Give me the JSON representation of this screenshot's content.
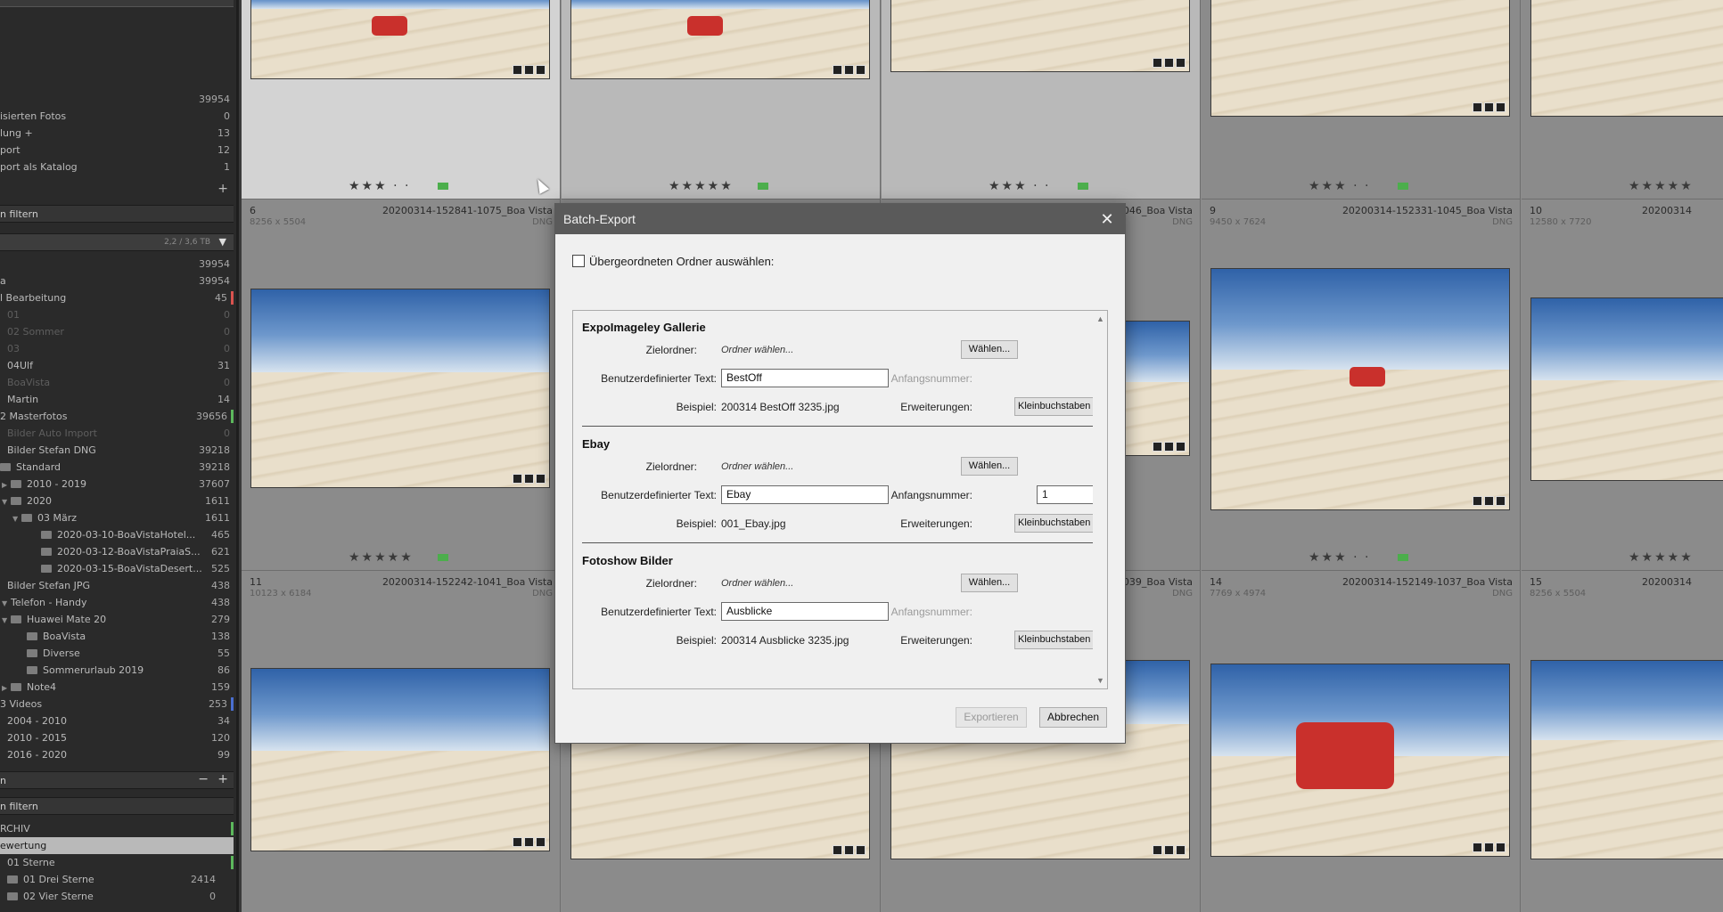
{
  "left_panel": {
    "total_count": "39954",
    "top_items": [
      {
        "label": "isierten Fotos",
        "count": "0"
      },
      {
        "label": "lung  +",
        "count": "13"
      },
      {
        "label": "port",
        "count": "12"
      },
      {
        "label": "port als Katalog",
        "count": "1"
      }
    ],
    "filter_header": "n filtern",
    "disk_info": "2,2 / 3,6 TB",
    "folders": [
      {
        "label": "",
        "count": "39954"
      },
      {
        "label": "a",
        "count": "39954"
      },
      {
        "label": "l Bearbeitung",
        "count": "45"
      },
      {
        "label": "01",
        "count": "0",
        "dim": true
      },
      {
        "label": "02 Sommer",
        "count": "0",
        "dim": true
      },
      {
        "label": "03",
        "count": "0",
        "dim": true
      },
      {
        "label": "04Ulf",
        "count": "31"
      },
      {
        "label": "BoaVista",
        "count": "0",
        "dim": true
      },
      {
        "label": "Martin",
        "count": "14"
      },
      {
        "label": "2 Masterfotos",
        "count": "39656"
      },
      {
        "label": "Bilder Auto Import",
        "count": "0",
        "dim": true
      },
      {
        "label": "Bilder Stefan DNG",
        "count": "39218"
      },
      {
        "label": "Standard",
        "count": "39218"
      },
      {
        "label": "2010 - 2019",
        "count": "37607"
      },
      {
        "label": "2020",
        "count": "1611"
      },
      {
        "label": "03 März",
        "count": "1611"
      },
      {
        "label": "2020-03-10-BoaVistaHotel...",
        "count": "465"
      },
      {
        "label": "2020-03-12-BoaVistaPraiaS...",
        "count": "621"
      },
      {
        "label": "2020-03-15-BoaVistaDesert...",
        "count": "525"
      },
      {
        "label": "Bilder Stefan JPG",
        "count": "438"
      },
      {
        "label": "Telefon - Handy",
        "count": "438"
      },
      {
        "label": "Huawei Mate 20",
        "count": "279"
      },
      {
        "label": "BoaVista",
        "count": "138"
      },
      {
        "label": "Diverse",
        "count": "55"
      },
      {
        "label": "Sommerurlaub 2019",
        "count": "86"
      },
      {
        "label": "Note4",
        "count": "159"
      },
      {
        "label": "3 Videos",
        "count": "253"
      },
      {
        "label": "2004 - 2010",
        "count": "34"
      },
      {
        "label": "2010 - 2015",
        "count": "120"
      },
      {
        "label": "2016 - 2020",
        "count": "99"
      }
    ],
    "collections_header": "n",
    "collections_filter": "n filtern",
    "collections": [
      {
        "label": "RCHIV",
        "count": ""
      },
      {
        "label": "ewertung",
        "count": ""
      },
      {
        "label": "01 Sterne",
        "count": ""
      },
      {
        "label": "01 Drei Sterne",
        "count": "2414"
      },
      {
        "label": "02 Vier Sterne",
        "count": "0"
      }
    ]
  },
  "grid": {
    "row2": [
      {
        "num": "6",
        "name": "20200314-152841-1075_Boa Vista",
        "dims": "8256 x 5504",
        "type": "DNG"
      },
      {
        "num": "",
        "name": "",
        "dims": "",
        "type": ""
      },
      {
        "num": "",
        "name": "1046_Boa Vista",
        "dims": "",
        "type": "DNG"
      },
      {
        "num": "9",
        "name": "20200314-152331-1045_Boa Vista",
        "dims": "9450 x 7624",
        "type": "DNG"
      },
      {
        "num": "10",
        "name": "20200314",
        "dims": "12580 x 7720",
        "type": ""
      }
    ],
    "row3": [
      {
        "num": "11",
        "name": "20200314-152242-1041_Boa Vista",
        "dims": "10123 x 6184",
        "type": "DNG"
      },
      {
        "num": "",
        "name": "",
        "dims": "",
        "type": ""
      },
      {
        "num": "",
        "name": "1039_Boa Vista",
        "dims": "",
        "type": "DNG"
      },
      {
        "num": "14",
        "name": "20200314-152149-1037_Boa Vista",
        "dims": "7769 x 4974",
        "type": "DNG"
      },
      {
        "num": "15",
        "name": "20200314",
        "dims": "8256 x 5504",
        "type": ""
      }
    ],
    "stars": {
      "three": "★★★ · ·",
      "five": "★★★★★"
    }
  },
  "dialog": {
    "title": "Batch-Export",
    "close": "✕",
    "parent_folder_label": "Übergeordneten Ordner auswählen:",
    "labels": {
      "target": "Zielordner:",
      "custom_text": "Benutzerdefinierter Text:",
      "start_number": "Anfangsnummer:",
      "example": "Beispiel:",
      "extensions": "Erweiterungen:"
    },
    "choose_folder_placeholder": "Ordner wählen...",
    "choose_button": "Wählen...",
    "extensions_value": "Kleinbuchstaben",
    "sections": [
      {
        "title": "ExpoImageley Gallerie",
        "custom_text": "BestOff",
        "start_number": "",
        "example": "200314 BestOff 3235.jpg"
      },
      {
        "title": "Ebay",
        "custom_text": "Ebay",
        "start_number": "1",
        "example": "001_Ebay.jpg"
      },
      {
        "title": "Fotoshow Bilder",
        "custom_text": "Ausblicke",
        "start_number": "",
        "example": "200314 Ausblicke 3235.jpg"
      }
    ],
    "export_button": "Exportieren",
    "cancel_button": "Abbrechen"
  }
}
